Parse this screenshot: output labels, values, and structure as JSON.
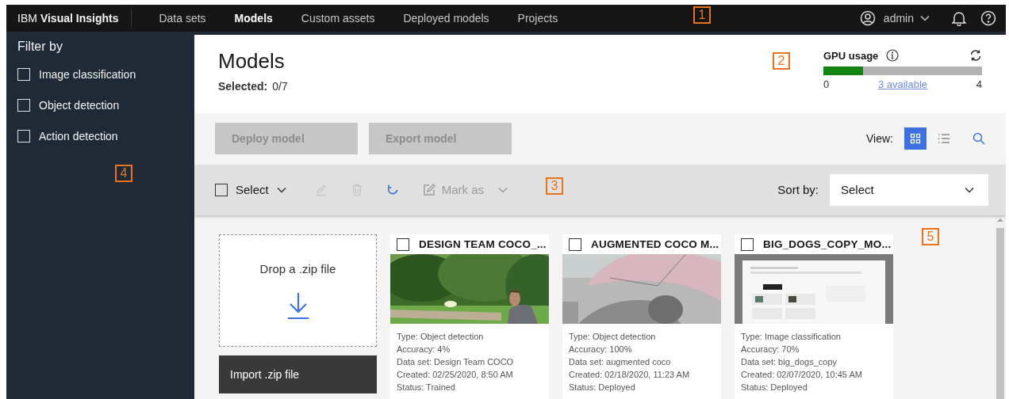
{
  "topbar": {
    "brand_prefix": "IBM",
    "brand_name": "Visual Insights",
    "nav": [
      {
        "label": "Data sets",
        "selected": false
      },
      {
        "label": "Models",
        "selected": true
      },
      {
        "label": "Custom assets",
        "selected": false
      },
      {
        "label": "Deployed models",
        "selected": false
      },
      {
        "label": "Projects",
        "selected": false
      }
    ],
    "user": "admin"
  },
  "sidebar": {
    "title": "Filter by",
    "filters": [
      {
        "label": "Image classification",
        "checked": false
      },
      {
        "label": "Object detection",
        "checked": false
      },
      {
        "label": "Action detection",
        "checked": false
      }
    ]
  },
  "header": {
    "title": "Models",
    "selected_label": "Selected:",
    "selected_value": "0/7",
    "gpu": {
      "title": "GPU usage",
      "level": 0.25,
      "min": "0",
      "available": "3 available",
      "max": "4"
    }
  },
  "actions": {
    "buttons": [
      {
        "label": "Deploy model",
        "disabled": true
      },
      {
        "label": "Export model",
        "disabled": true
      }
    ],
    "view_label": "View:",
    "views": [
      {
        "kind": "grid",
        "selected": true
      },
      {
        "kind": "list",
        "selected": false
      }
    ]
  },
  "toolbar": {
    "select_all_checked": false,
    "select_label": "Select",
    "tools": [
      {
        "kind": "edit",
        "disabled": true
      },
      {
        "kind": "delete",
        "disabled": true
      },
      {
        "kind": "refresh",
        "disabled": false
      }
    ],
    "mark_as": {
      "label": "Mark as",
      "disabled": true
    },
    "sort_label": "Sort by:",
    "sort_value": "Select"
  },
  "dropzone": {
    "text": "Drop a .zip file",
    "button": "Import .zip file"
  },
  "cards": [
    {
      "title": "DESIGN TEAM COCO_...",
      "checked": false,
      "fields": [
        {
          "label": "Type:",
          "value": "Object detection"
        },
        {
          "label": "Accuracy:",
          "value": "4%"
        },
        {
          "label": "Data set:",
          "value": "Design Team COCO"
        },
        {
          "label": "Created:",
          "value": "02/25/2020, 8:50 AM"
        },
        {
          "label": "Status:",
          "value": "Trained"
        }
      ]
    },
    {
      "title": "AUGMENTED COCO M...",
      "checked": false,
      "fields": [
        {
          "label": "Type:",
          "value": "Object detection"
        },
        {
          "label": "Accuracy:",
          "value": "100%"
        },
        {
          "label": "Data set:",
          "value": "augmented coco"
        },
        {
          "label": "Created:",
          "value": "02/18/2020, 11:23 AM"
        },
        {
          "label": "Status:",
          "value": "Deployed"
        }
      ]
    },
    {
      "title": "BIG_DOGS_COPY_MO...",
      "checked": false,
      "fields": [
        {
          "label": "Type:",
          "value": "Image classification"
        },
        {
          "label": "Accuracy:",
          "value": "70%"
        },
        {
          "label": "Data set:",
          "value": "big_dogs_copy"
        },
        {
          "label": "Created:",
          "value": "02/07/2020, 10:45 AM"
        },
        {
          "label": "Status:",
          "value": "Deployed"
        }
      ]
    }
  ],
  "callouts": [
    "1",
    "2",
    "3",
    "4",
    "5"
  ]
}
